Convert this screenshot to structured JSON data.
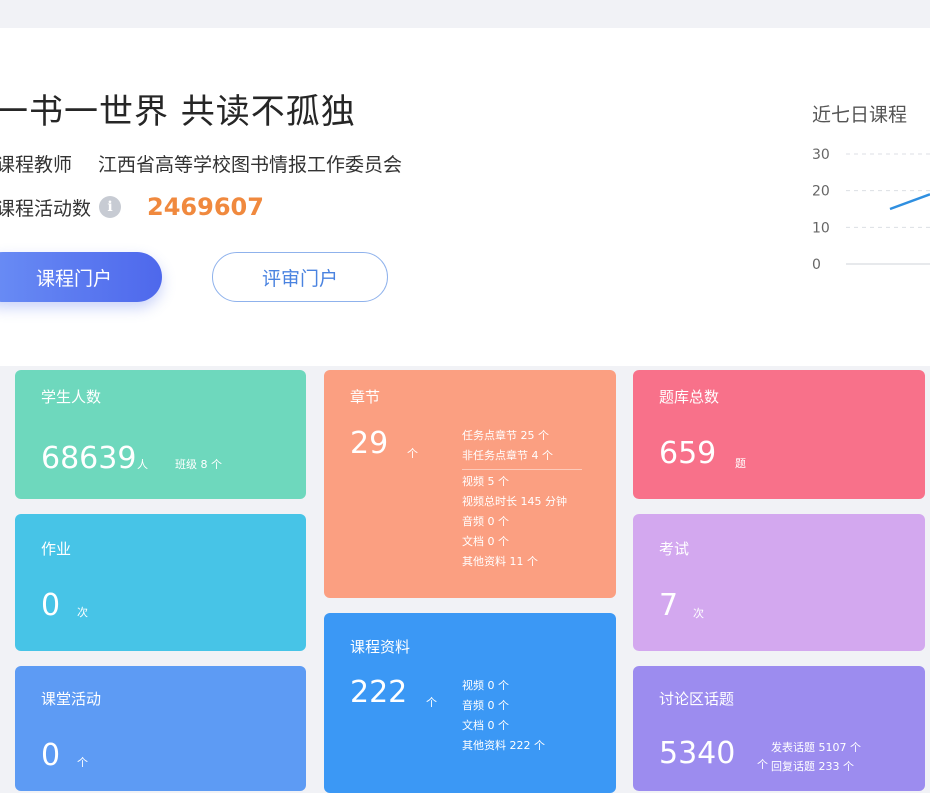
{
  "header": {
    "title": "一书一世界 共读不孤独",
    "teacher_label": "课程教师",
    "teacher_value": "江西省高等学校图书情报工作委员会",
    "activity_label": "课程活动数",
    "activity_value": "2469607",
    "portal_button": "课程门户",
    "review_button": "评审门户"
  },
  "chart_data": {
    "type": "line",
    "title": "近七日课程",
    "y_ticks": [
      "30",
      "20",
      "10",
      "0"
    ],
    "ylim": [
      0,
      30
    ],
    "grid": true,
    "series": [
      {
        "values": [
          15,
          19
        ]
      }
    ],
    "color": "#2f8fe0"
  },
  "cards": {
    "students": {
      "label": "学生人数",
      "value": "68639",
      "unit": "人",
      "sub": "班级 8 个",
      "color": "#6ed8bd"
    },
    "chapters": {
      "label": "章节",
      "value": "29",
      "unit": "个",
      "color": "#fb9f81",
      "details_top": [
        "任务点章节 25 个",
        "非任务点章节 4 个"
      ],
      "details_bottom": [
        "视频 5 个",
        "视频总时长 145 分钟",
        "音频 0 个",
        "文档 0 个",
        "其他资料 11 个"
      ]
    },
    "questions": {
      "label": "题库总数",
      "value": "659",
      "unit": "题",
      "color": "#f8718a"
    },
    "homework": {
      "label": "作业",
      "value": "0",
      "unit": "次",
      "color": "#47c4e7"
    },
    "exam": {
      "label": "考试",
      "value": "7",
      "unit": "次",
      "color": "#d3a8ef"
    },
    "resources": {
      "label": "课程资料",
      "value": "222",
      "unit": "个",
      "color": "#3b98f5",
      "details": [
        "视频 0 个",
        "音频 0 个",
        "文档 0 个",
        "其他资料 222 个"
      ]
    },
    "classroom": {
      "label": "课堂活动",
      "value": "0",
      "unit": "个",
      "color": "#5d9bf4"
    },
    "discussion": {
      "label": "讨论区话题",
      "value": "5340",
      "unit": "个",
      "color": "#9c8cef",
      "details": [
        "发表话题 5107 个",
        "回复话题 233 个"
      ]
    }
  }
}
